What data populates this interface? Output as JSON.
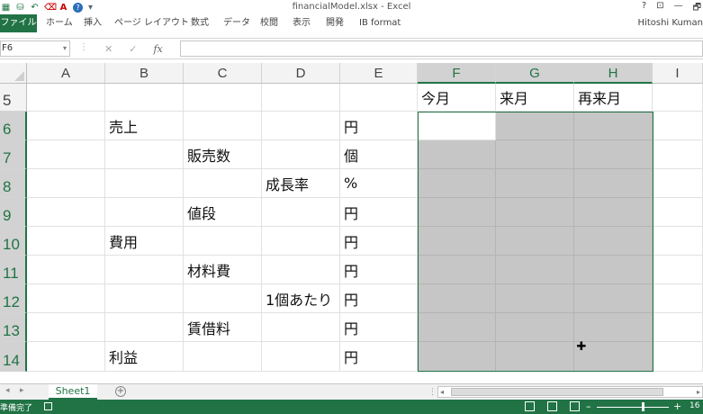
{
  "window": {
    "title": "financialModel.xlsx - Excel",
    "help": "?",
    "controls": [
      "?",
      "⊡",
      "—",
      "🗗"
    ]
  },
  "qat": {
    "icons": [
      "excel-icon",
      "save-icon",
      "undo-icon",
      "redo-icon",
      "font-color-icon",
      "help-icon"
    ]
  },
  "ribbon": {
    "tabs": [
      "ファイル",
      "ホーム",
      "挿入",
      "ページ レイアウト",
      "数式",
      "データ",
      "校閲",
      "表示",
      "開発",
      "IB format"
    ],
    "user": "Hitoshi Kuman"
  },
  "formula_bar": {
    "name_box": "F6",
    "formula": ""
  },
  "sheet": {
    "columns": [
      "A",
      "B",
      "C",
      "D",
      "E",
      "F",
      "G",
      "H",
      "I"
    ],
    "selected_columns": [
      "F",
      "G",
      "H"
    ],
    "rows": [
      "5",
      "6",
      "7",
      "8",
      "9",
      "10",
      "11",
      "12",
      "13",
      "14"
    ],
    "selected_rows": [
      "6",
      "7",
      "8",
      "9",
      "10",
      "11",
      "12",
      "13",
      "14"
    ],
    "cells": {
      "F5": "今月",
      "G5": "来月",
      "H5": "再来月",
      "B6": "売上",
      "E6": "円",
      "C7": "販売数",
      "E7": "個",
      "D8": "成長率",
      "E8": "%",
      "C9": "値段",
      "E9": "円",
      "B10": "費用",
      "E10": "円",
      "C11": "材料費",
      "E11": "円",
      "D12": "1個あたり",
      "E12": "円",
      "C13": "賃借料",
      "E13": "円",
      "B14": "利益",
      "E14": "円"
    },
    "active_cell": "F6",
    "selection": "F6:H14"
  },
  "sheet_tabs": {
    "tabs": [
      "Sheet1"
    ],
    "active": "Sheet1"
  },
  "status": {
    "text": "準備完了",
    "zoom_text": "16"
  },
  "colors": {
    "accent": "#217346",
    "selection_fill": "#c6c6c6"
  }
}
